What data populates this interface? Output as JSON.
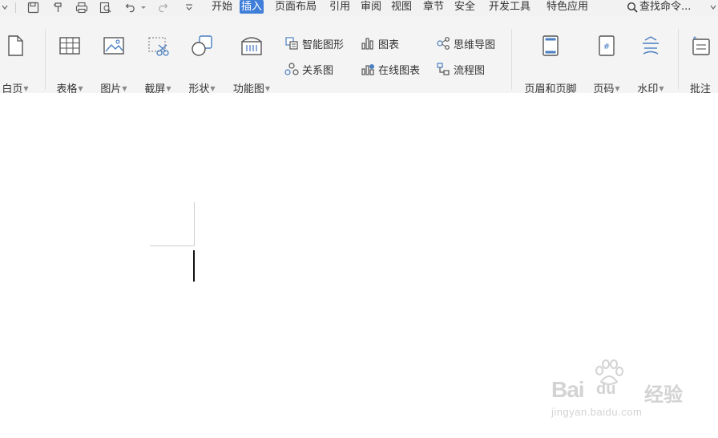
{
  "menu": {
    "tabs": [
      "开始",
      "插入",
      "页面布局",
      "引用",
      "审阅",
      "视图",
      "章节",
      "安全",
      "开发工具",
      "特色应用"
    ],
    "active_tab": "插入",
    "search_label": "查找命令..."
  },
  "ribbon": {
    "blank_page": "白页",
    "table": "表格",
    "picture": "图片",
    "screenshot": "截屏",
    "shape": "形状",
    "function_chart": "功能图",
    "smart_art": "智能图形",
    "chart": "图表",
    "mind_map": "思维导图",
    "relation_chart": "关系图",
    "online_chart": "在线图表",
    "flowchart": "流程图",
    "header_footer": "页眉和页脚",
    "page_number": "页码",
    "watermark": "水印",
    "comment": "批注"
  },
  "watermark_overlay": {
    "brand_latin": "Bai",
    "brand_du": "du",
    "brand_cn": "经验",
    "url": "jingyan.baidu.com"
  },
  "colors": {
    "active_tab_bg": "#3f7fd9",
    "icon_blue": "#4a7fc1",
    "ribbon_bg": "#f4f4f4"
  }
}
